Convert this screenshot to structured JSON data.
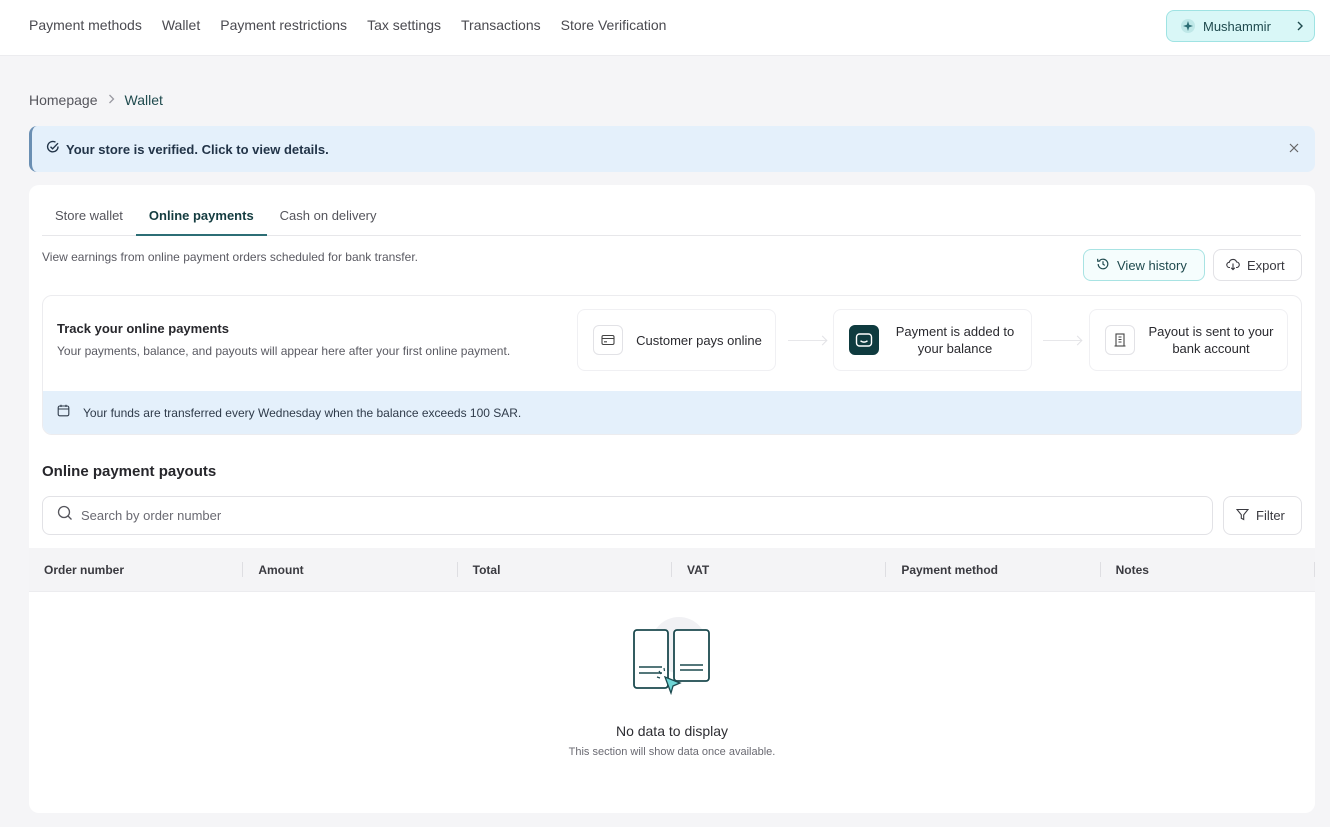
{
  "topnav": {
    "items": [
      {
        "label": "Payment methods"
      },
      {
        "label": "Wallet"
      },
      {
        "label": "Payment restrictions"
      },
      {
        "label": "Tax settings"
      },
      {
        "label": "Transactions"
      },
      {
        "label": "Store Verification"
      }
    ],
    "user": {
      "name": "Mushammir",
      "icon": "sparkle-icon"
    }
  },
  "breadcrumb": {
    "home": "Homepage",
    "current": "Wallet"
  },
  "banner": {
    "text": "Your store is verified. Click to view details."
  },
  "tabs": [
    {
      "label": "Store wallet",
      "active": false
    },
    {
      "label": "Online payments",
      "active": true
    },
    {
      "label": "Cash on delivery",
      "active": false
    }
  ],
  "description": "View earnings from online payment orders scheduled for bank transfer.",
  "actions": {
    "history": "View history",
    "export": "Export"
  },
  "tracker": {
    "title": "Track your online payments",
    "subtitle": "Your payments, balance, and payouts will appear here after your first online payment.",
    "steps": [
      {
        "label": "Customer pays online",
        "icon": "card-icon"
      },
      {
        "label": "Payment is added to your balance",
        "icon": "wallet-icon"
      },
      {
        "label": "Payout is sent to your bank account",
        "icon": "bank-icon"
      }
    ],
    "funds_note": "Your funds are transferred every Wednesday when the balance exceeds 100 SAR."
  },
  "payouts": {
    "title": "Online payment payouts",
    "search_placeholder": "Search by order number",
    "filter": "Filter",
    "columns": [
      "Order number",
      "Amount",
      "Total",
      "VAT",
      "Payment method",
      "Notes"
    ],
    "empty_title": "No data to display",
    "empty_subtitle": "This section will show data once available."
  },
  "colors": {
    "accent": "#2c6e75",
    "dark": "#0f3b3f",
    "info_bg": "#e4f0fb"
  }
}
